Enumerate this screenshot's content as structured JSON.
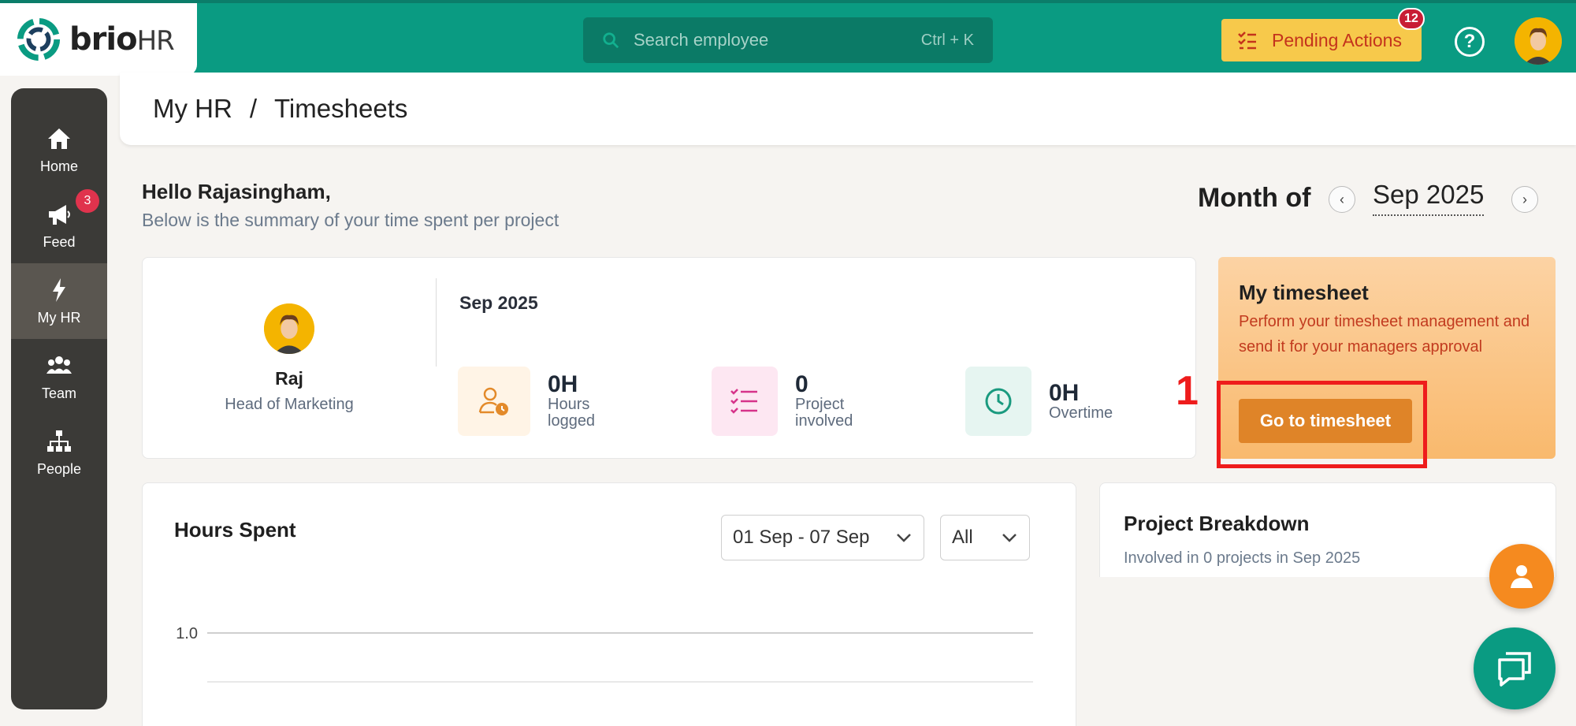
{
  "brand": {
    "name": "brio",
    "suffix": "HR"
  },
  "search": {
    "placeholder": "Search employee",
    "shortcut": "Ctrl + K"
  },
  "pending": {
    "label": "Pending Actions",
    "count": "12"
  },
  "help": {
    "glyph": "?"
  },
  "sidebar": {
    "items": [
      {
        "label": "Home",
        "icon": "home-icon"
      },
      {
        "label": "Feed",
        "icon": "megaphone-icon",
        "badge": "3"
      },
      {
        "label": "My HR",
        "icon": "lightning-icon",
        "active": true
      },
      {
        "label": "Team",
        "icon": "team-icon"
      },
      {
        "label": "People",
        "icon": "org-chart-icon"
      }
    ]
  },
  "breadcrumb": {
    "parent": "My HR",
    "separator": "/",
    "current": "Timesheets"
  },
  "greeting": {
    "title": "Hello Rajasingham,",
    "subtitle": "Below is the summary of your time spent per project"
  },
  "month": {
    "label": "Month of",
    "value": "Sep 2025",
    "prev": "‹",
    "next": "›"
  },
  "summary": {
    "name": "Raj",
    "role": "Head of Marketing",
    "month": "Sep 2025",
    "stats": [
      {
        "value": "0H",
        "label_line1": "Hours",
        "label_line2": "logged",
        "icon": "user-clock-icon",
        "color": "#e38a2a",
        "bg": "#fff4e6"
      },
      {
        "value": "0",
        "label_line1": "Project",
        "label_line2": "involved",
        "icon": "checklist-icon",
        "color": "#d6338a",
        "bg": "#fde7f2"
      },
      {
        "value": "0H",
        "label_line1": "Overtime",
        "label_line2": "",
        "icon": "clock-icon",
        "color": "#1a9a7f",
        "bg": "#e6f5f1"
      }
    ]
  },
  "timesheet": {
    "title": "My timesheet",
    "description": "Perform your timesheet management and send it for your managers approval",
    "button": "Go to timesheet"
  },
  "annotation": {
    "number": "1",
    "color": "#ee1c1c"
  },
  "hours": {
    "title": "Hours Spent",
    "range": "01 Sep - 07 Sep",
    "filter": "All"
  },
  "chart_data": {
    "type": "line",
    "y_ticks": [
      "1.0"
    ],
    "series": []
  },
  "project_breakdown": {
    "title": "Project Breakdown",
    "subtitle": "Involved in 0 projects in Sep 2025"
  },
  "colors": {
    "topbar": "#0a9b82",
    "accent": "#df8428",
    "sidebar": "#3b3a37"
  }
}
